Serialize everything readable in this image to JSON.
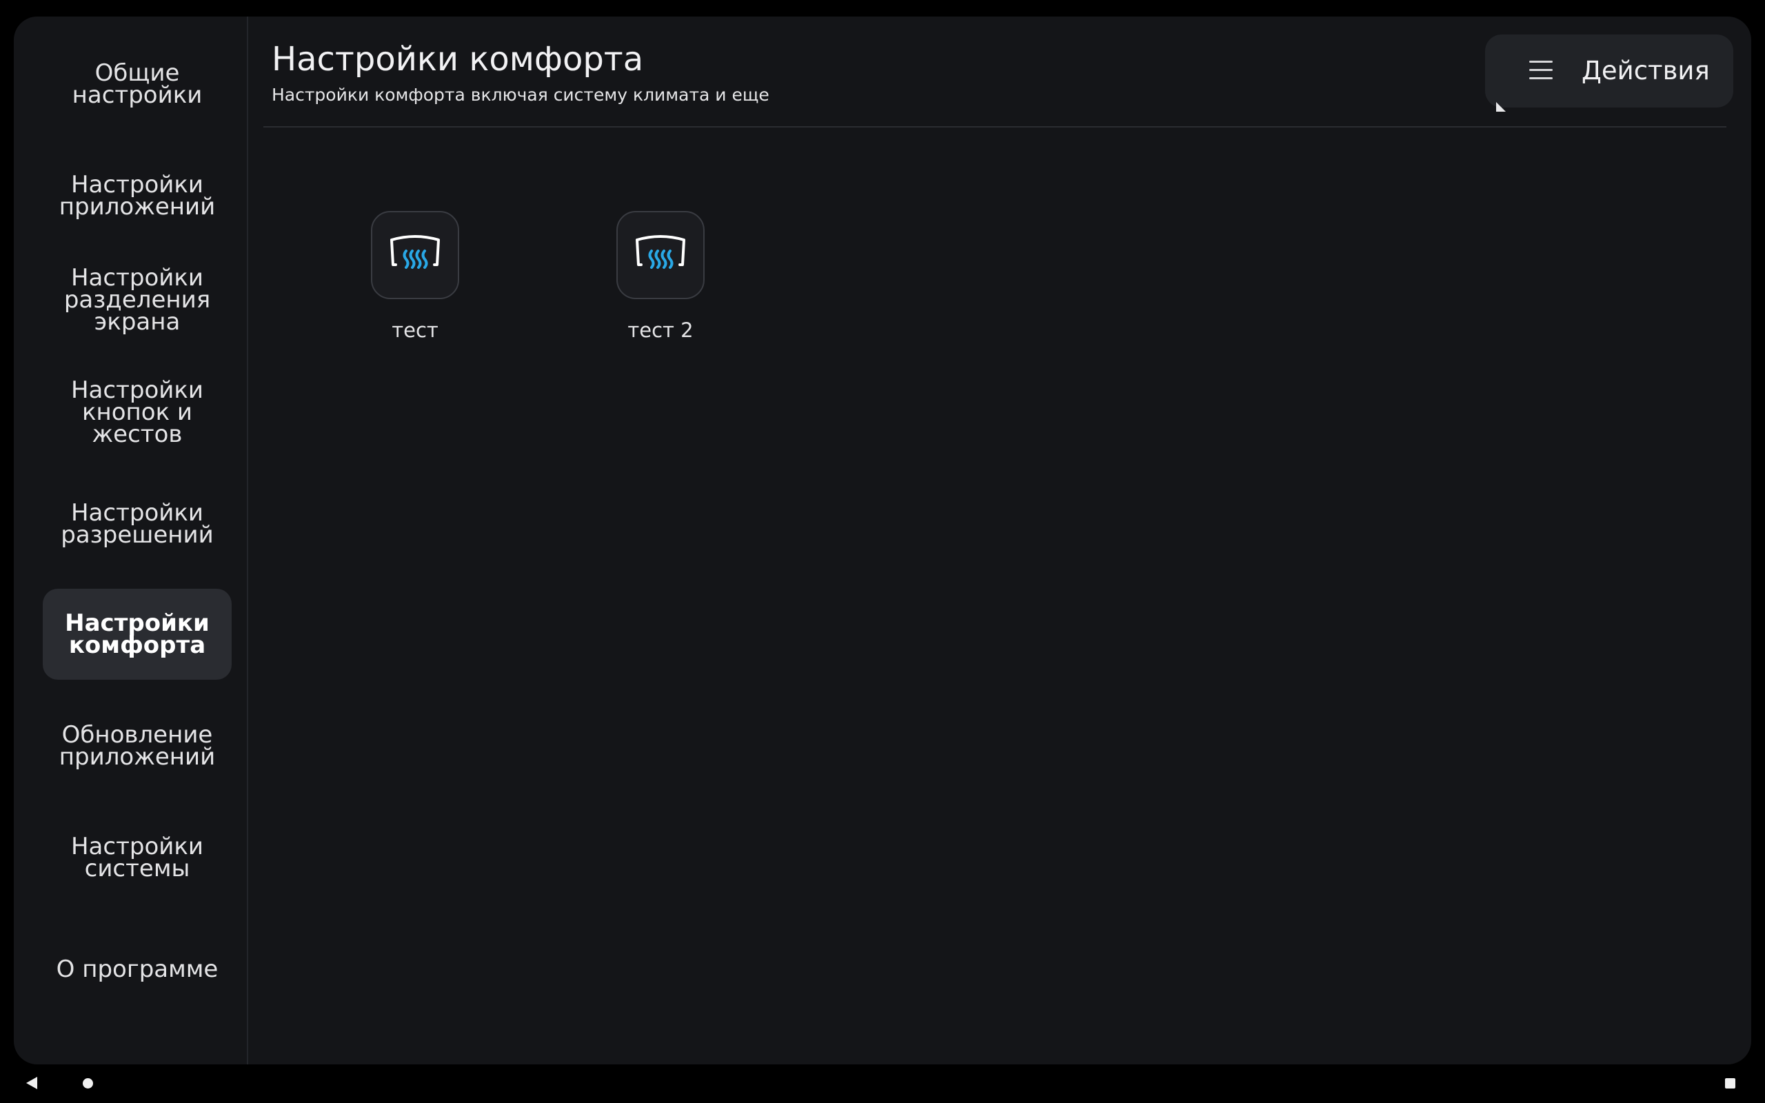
{
  "sidebar": {
    "items": [
      {
        "label": "Общие\nнастройки",
        "active": false
      },
      {
        "label": "Настройки\nприложений",
        "active": false
      },
      {
        "label": "Настройки\nразделения\nэкрана",
        "active": false
      },
      {
        "label": "Настройки\nкнопок и\nжестов",
        "active": false
      },
      {
        "label": "Настройки\nразрешений",
        "active": false
      },
      {
        "label": "Настройки\nкомфорта",
        "active": true
      },
      {
        "label": "Обновление\nприложений",
        "active": false
      },
      {
        "label": "Настройки\nсистемы",
        "active": false
      },
      {
        "label": "О программе",
        "active": false
      }
    ]
  },
  "header": {
    "title": "Настройки комфорта",
    "subtitle": "Настройки комфорта включая систему климата и еще",
    "actions_label": "Действия"
  },
  "tiles": [
    {
      "label": "тест",
      "icon": "windshield-defrost-icon"
    },
    {
      "label": "тест 2",
      "icon": "windshield-defrost-icon"
    }
  ],
  "colors": {
    "background": "#141518",
    "active_item": "#2a2c31",
    "accent_heat": "#29a8e6",
    "icon_outline": "#ffffff"
  },
  "navbar": {
    "icons": [
      "back-icon",
      "home-icon",
      "recents-icon"
    ]
  }
}
